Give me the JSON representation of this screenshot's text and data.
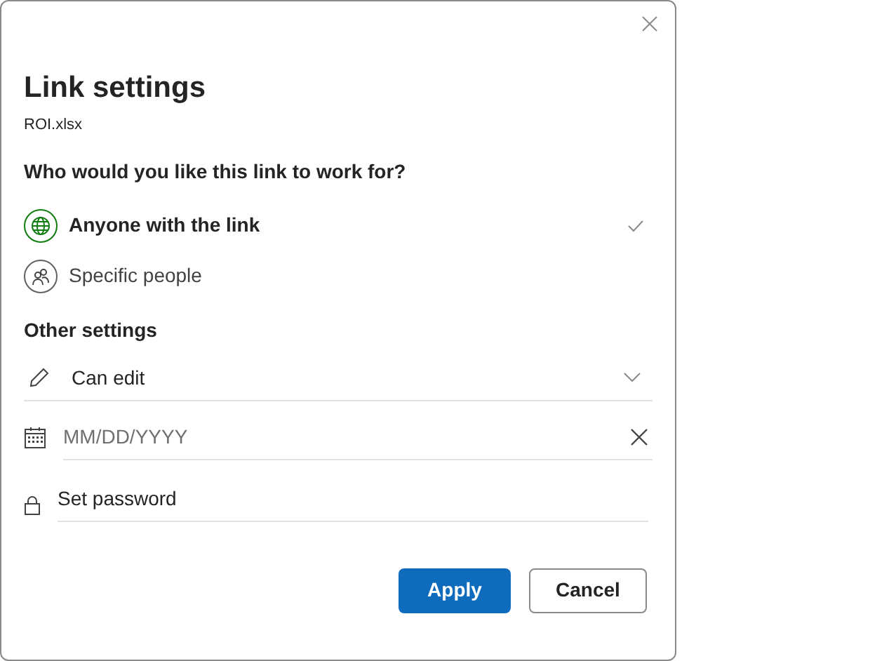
{
  "dialog": {
    "title": "Link settings",
    "filename": "ROI.xlsx",
    "question": "Who would you like this link to work for?",
    "options": [
      {
        "kind": "globe",
        "label": "Anyone with the link",
        "selected": true
      },
      {
        "kind": "people",
        "label": "Specific people",
        "selected": false
      }
    ],
    "other_settings": {
      "heading": "Other settings",
      "permission": {
        "value": "Can edit"
      },
      "expiry": {
        "placeholder": "MM/DD/YYYY"
      },
      "password": {
        "placeholder": "Set password"
      }
    },
    "buttons": [
      {
        "kind": "primary",
        "label": "Apply"
      },
      {
        "kind": "secondary",
        "label": "Cancel"
      }
    ]
  }
}
